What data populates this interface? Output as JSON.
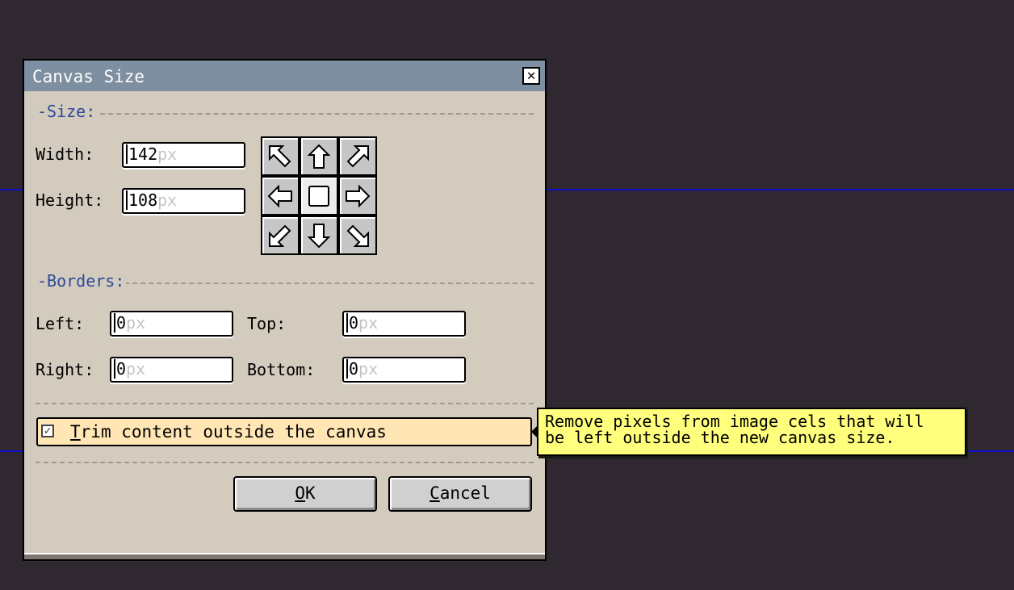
{
  "dialog": {
    "title": "Canvas Size",
    "close_glyph": "✕",
    "sections": {
      "size": "-Size:",
      "borders": "-Borders:"
    },
    "size": {
      "width_label": "Width:",
      "width_value": "142",
      "height_label": "Height:",
      "height_value": "108",
      "unit": "px"
    },
    "anchor_icons": [
      "arrow-up-left-icon",
      "arrow-up-icon",
      "arrow-up-right-icon",
      "arrow-left-icon",
      "anchor-center-icon",
      "arrow-right-icon",
      "arrow-down-left-icon",
      "arrow-down-icon",
      "arrow-down-right-icon"
    ],
    "borders": {
      "left_label": "Left:",
      "left_value": "0",
      "top_label": "Top:",
      "top_value": "0",
      "right_label": "Right:",
      "right_value": "0",
      "bottom_label": "Bottom:",
      "bottom_value": "0",
      "unit": "px"
    },
    "trim": {
      "checked": true,
      "label_first": "T",
      "label_rest": "rim content outside the canvas"
    },
    "buttons": {
      "ok_u": "O",
      "ok_rest": "K",
      "cancel_u": "C",
      "cancel_rest": "ancel"
    }
  },
  "tooltip": {
    "line1": "Remove pixels from image cels that will",
    "line2": "be left outside the new canvas size."
  },
  "colors": {
    "background": "#2f2830",
    "dialog": "#d3cbbd",
    "titlebar": "#7d8fa0",
    "section_label": "#2e4a9a",
    "tooltip": "#ffff7d",
    "checkbox_row": "#ffe6b4",
    "guide_line": "#1010c8"
  }
}
